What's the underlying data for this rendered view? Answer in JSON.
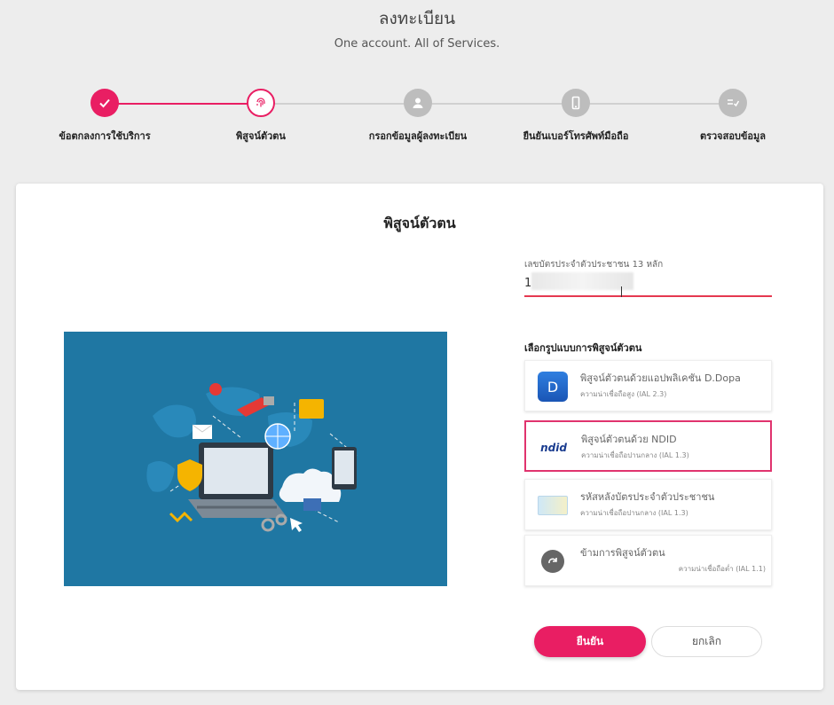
{
  "header": {
    "title": "ลงทะเบียน",
    "subtitle": "One account. All of Services."
  },
  "steps": [
    {
      "label": "ข้อตกลงการใช้บริการ",
      "state": "done",
      "icon": "check-icon"
    },
    {
      "label": "พิสูจน์ตัวตน",
      "state": "active",
      "icon": "fingerprint-icon"
    },
    {
      "label": "กรอกข้อมูลผู้ลงทะเบียน",
      "state": "pending",
      "icon": "user-icon"
    },
    {
      "label": "ยืนยันเบอร์โทรศัพท์มือถือ",
      "state": "pending",
      "icon": "phone-icon"
    },
    {
      "label": "ตรวจสอบข้อมูล",
      "state": "pending",
      "icon": "checklist-icon"
    }
  ],
  "card": {
    "title": "พิสูจน์ตัวตน",
    "id_field": {
      "label": "เลขบัตรประจำตัวประชาชน 13 หลัก",
      "value": "1"
    },
    "method_heading": "เลือกรูปแบบการพิสูจน์ตัวตน",
    "options": [
      {
        "title": "พิสูจน์ตัวตนด้วยแอปพลิเคชัน D.Dopa",
        "sub": "ความน่าเชื่อถือสูง (IAL 2.3)",
        "icon": "ddopa-app-icon",
        "icon_letter": "D"
      },
      {
        "title": "พิสูจน์ตัวตนด้วย NDID",
        "sub": "ความน่าเชื่อถือปานกลาง (IAL 1.3)",
        "icon": "ndid-logo-icon",
        "icon_letter": "ndid"
      },
      {
        "title": "รหัสหลังบัตรประจำตัวประชาชน",
        "sub": "ความน่าเชื่อถือปานกลาง (IAL 1.3)",
        "icon": "id-card-icon"
      },
      {
        "title": "ข้ามการพิสูจน์ตัวตน",
        "sub": "ความน่าเชื่อถือต่ำ (IAL 1.1)",
        "icon": "skip-icon"
      }
    ],
    "buttons": {
      "confirm": "ยืนยัน",
      "cancel": "ยกเลิก"
    }
  },
  "colors": {
    "accent": "#e91e63",
    "pending": "#bdbdbd",
    "illustration_bg": "#1f77a3"
  }
}
